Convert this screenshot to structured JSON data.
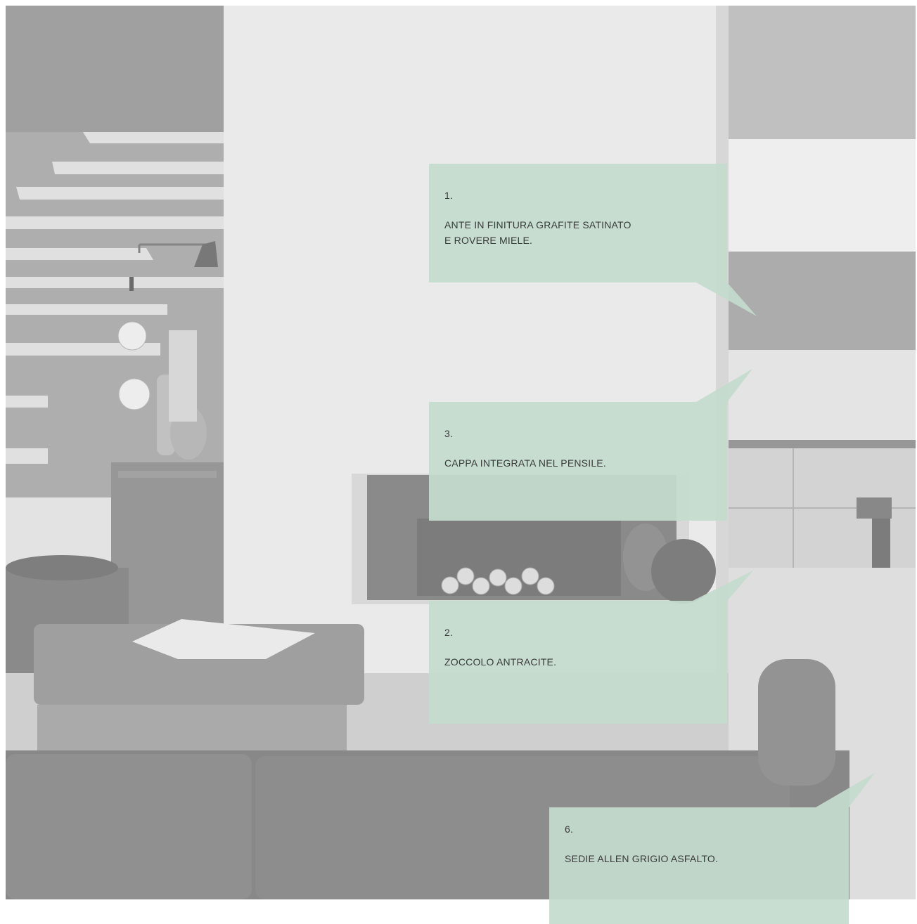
{
  "callouts": [
    {
      "number": "1.",
      "text": "ANTE IN FINITURA GRAFITE SATINATO\nE ROVERE MIELE."
    },
    {
      "number": "3.",
      "text": "CAPPA INTEGRATA NEL PENSILE."
    },
    {
      "number": "2.",
      "text": "ZOCCOLO ANTRACITE."
    },
    {
      "number": "6.",
      "text": "SEDIE ALLEN GRIGIO ASFALTO."
    }
  ],
  "colors": {
    "callout_fill": "#c3dccd",
    "photo_tone": "#b4b4b4"
  }
}
